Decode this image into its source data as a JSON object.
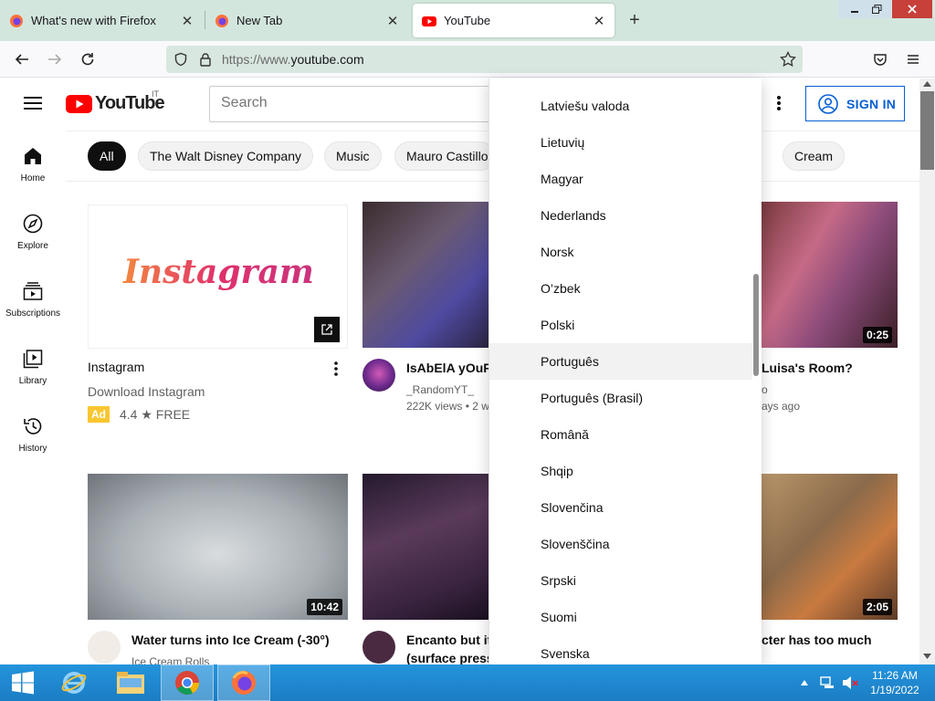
{
  "browser": {
    "tabs": [
      {
        "title": "What's new with Firefox",
        "active": false
      },
      {
        "title": "New Tab",
        "active": false
      },
      {
        "title": "YouTube",
        "active": true
      }
    ],
    "url_scheme": "https://www.",
    "url_host": "youtube.com"
  },
  "youtube": {
    "logo_text": "YouTube",
    "country_code": "IT",
    "search_placeholder": "Search",
    "sign_in": "SIGN IN",
    "guide": [
      {
        "label": "Home",
        "icon": "home-icon"
      },
      {
        "label": "Explore",
        "icon": "compass-icon"
      },
      {
        "label": "Subscriptions",
        "icon": "subscriptions-icon"
      },
      {
        "label": "Library",
        "icon": "library-icon"
      },
      {
        "label": "History",
        "icon": "history-icon"
      }
    ],
    "chips": [
      "All",
      "The Walt Disney Company",
      "Music",
      "Mauro Castillo",
      "Cream"
    ],
    "videos": [
      {
        "title": "Instagram",
        "line2": "Download Instagram",
        "badge": "Ad",
        "rating": "4.4 ★ FREE",
        "thumb_text": "Instagram"
      },
      {
        "title": "IsAbElA yOuR",
        "channel": "_RandomYT_",
        "meta": "222K views • 2 w"
      },
      {
        "title": "Luisa's Room?",
        "channel": "o",
        "meta": "ays ago",
        "duration": "0:25"
      },
      {
        "title": "Water turns into Ice Cream (-30°)",
        "channel": "Ice Cream Rolls",
        "duration": "10:42"
      },
      {
        "title": "Encanto but it'",
        "title2": "(surface press"
      },
      {
        "title": "cter has too much",
        "duration": "2:05"
      }
    ]
  },
  "language_menu": {
    "items": [
      "Latviešu valoda",
      "Lietuvių",
      "Magyar",
      "Nederlands",
      "Norsk",
      "O’zbek",
      "Polski",
      "Português",
      "Português (Brasil)",
      "Română",
      "Shqip",
      "Slovenčina",
      "Slovenščina",
      "Srpski",
      "Suomi",
      "Svenska"
    ],
    "hovered": "Português"
  },
  "taskbar": {
    "time": "11:26 AM",
    "date": "1/19/2022",
    "apps": [
      "internet-explorer",
      "file-explorer",
      "chrome",
      "firefox"
    ]
  }
}
